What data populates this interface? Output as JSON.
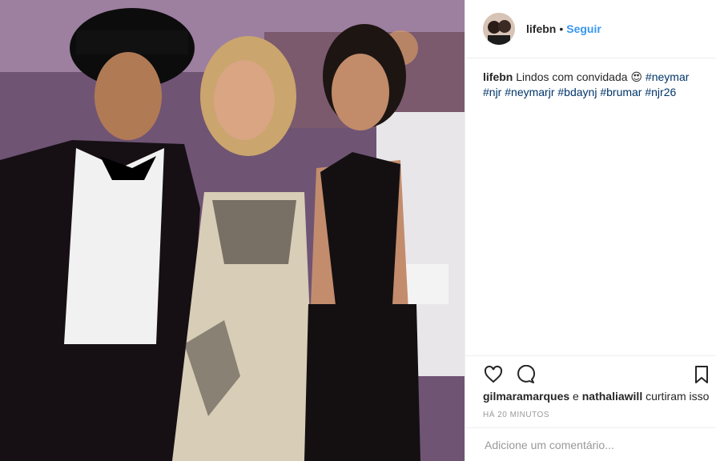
{
  "post": {
    "photo_description": "",
    "username": "lifebn",
    "separator": "•",
    "follow_label": "Seguir",
    "caption_user": "lifebn",
    "caption_text": "Lindos com convidada 😍",
    "hashtags": [
      "#neymar",
      "#njr",
      "#neymarjr",
      "#bdaynj",
      "#brumar",
      "#njr26"
    ],
    "liked_by_1": "gilmaramarques",
    "liked_by_conj": " e ",
    "liked_by_2": "nathaliawill",
    "liked_suffix": " curtiram isso",
    "time_ago": "HÁ 20 MINUTOS",
    "comment_placeholder": "Adicione um comentário..."
  },
  "icons": {
    "like": "heart-icon",
    "comment": "comment-icon",
    "save": "bookmark-icon"
  },
  "colors": {
    "link": "#3897f0",
    "hashtag": "#003569",
    "muted": "#999999"
  }
}
